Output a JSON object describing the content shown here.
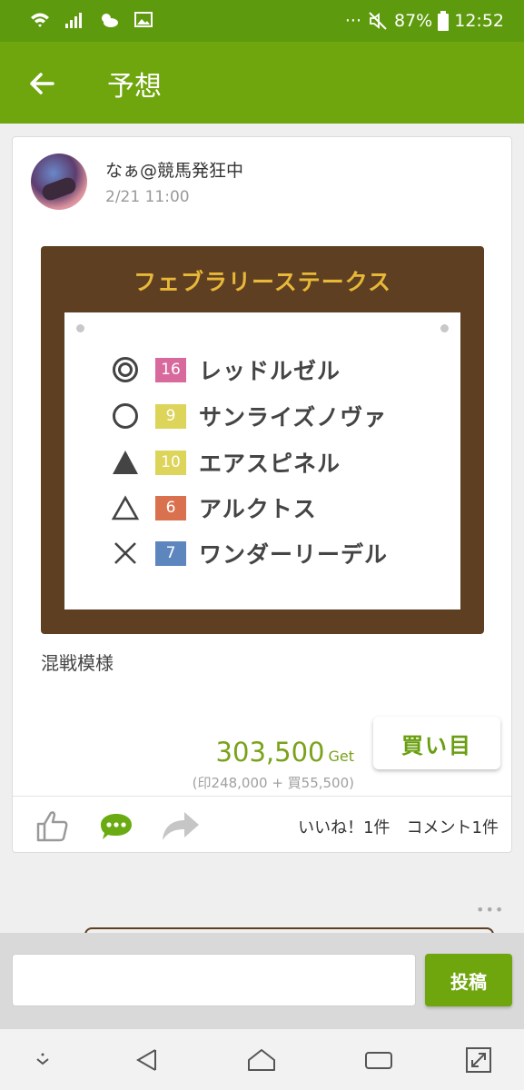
{
  "status_bar": {
    "battery": "87%",
    "time": "12:52",
    "dots": "···",
    "icons": [
      "wifi-icon",
      "signal-icon",
      "weather-icon",
      "image-icon",
      "mute-icon",
      "battery-icon"
    ]
  },
  "app_bar": {
    "title": "予想",
    "back_icon": "arrow-left-icon"
  },
  "post": {
    "username": "なぁ@競馬発狂中",
    "timestamp": "2/21 11:00",
    "race_name": "フェブラリーステークス",
    "picks": [
      {
        "mark": "◎",
        "mark_icon": "double-circle-icon",
        "number": "16",
        "color": "#d7699d",
        "horse": "レッドルゼル"
      },
      {
        "mark": "○",
        "mark_icon": "circle-icon",
        "number": "9",
        "color": "#ddd45a",
        "horse": "サンライズノヴァ"
      },
      {
        "mark": "▲",
        "mark_icon": "filled-triangle-icon",
        "number": "10",
        "color": "#ddd45a",
        "horse": "エアスピネル"
      },
      {
        "mark": "△",
        "mark_icon": "triangle-icon",
        "number": "6",
        "color": "#d9714e",
        "horse": "アルクトス"
      },
      {
        "mark": "×",
        "mark_icon": "cross-icon",
        "number": "7",
        "color": "#5d86bf",
        "horse": "ワンダーリーデル"
      }
    ],
    "comment": "混戦模様",
    "prize": "303,500",
    "prize_unit": "Get",
    "prize_detail": "(印248,000 + 買55,500)",
    "buy_button": "買い目",
    "counts": "いいね！1件　コメント1件",
    "actions": [
      "thumbs-up-icon",
      "comment-bubble-icon",
      "share-arrow-icon"
    ]
  },
  "more": "•••",
  "composer": {
    "placeholder": "",
    "value": "",
    "submit": "投稿"
  },
  "nav_bar": [
    "nav-down-icon",
    "back-triangle-icon",
    "home-icon",
    "recents-icon",
    "expand-icon"
  ]
}
